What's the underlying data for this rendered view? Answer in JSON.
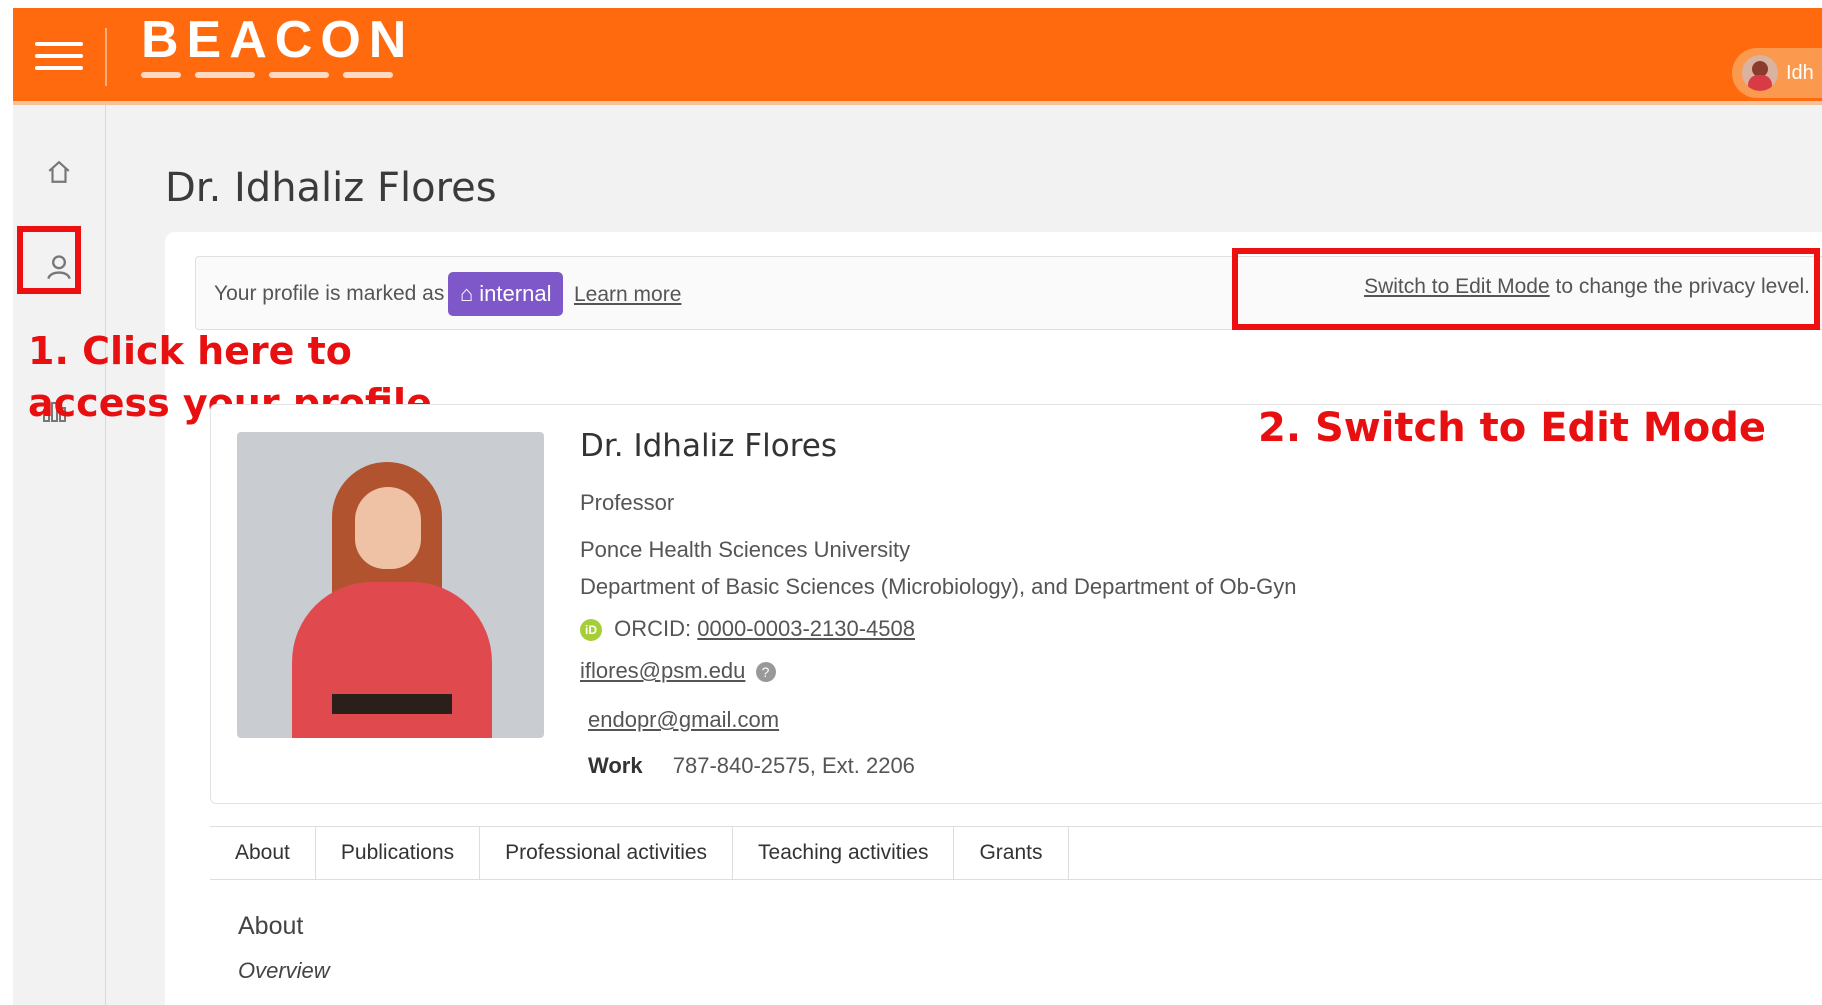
{
  "header": {
    "logo_text": "BEACON",
    "user_name": "Idh",
    "accent_color": "#ff6a0e"
  },
  "sidebar": {
    "items": [
      {
        "name": "home",
        "icon": "home-icon"
      },
      {
        "name": "profile",
        "icon": "user-icon"
      },
      {
        "name": "analytics",
        "icon": "bar-chart-icon"
      }
    ]
  },
  "page": {
    "title": "Dr. Idhaliz Flores"
  },
  "privacy": {
    "prefix": "Your profile is marked as",
    "badge_label": "internal",
    "badge_icon": "house-icon",
    "learn_more": "Learn more",
    "switch_link": "Switch to Edit Mode",
    "switch_suffix": "to change the privacy level."
  },
  "annotations": {
    "step1": "1. Click here to access your profile",
    "step2": "2. Switch to Edit Mode",
    "color": "#e80f10"
  },
  "profile": {
    "name": "Dr. Idhaliz Flores",
    "title": "Professor",
    "institution": "Ponce Health Sciences University",
    "department": "Department of Basic Sciences (Microbiology), and Department of Ob-Gyn",
    "orcid_label": "ORCID:",
    "orcid": "0000-0003-2130-4508",
    "email_primary": "iflores@psm.edu",
    "email_secondary": "endopr@gmail.com",
    "phone_label": "Work",
    "phone": "787-840-2575, Ext. 2206"
  },
  "tabs": [
    "About",
    "Publications",
    "Professional activities",
    "Teaching activities",
    "Grants"
  ],
  "about": {
    "heading": "About",
    "subheading": "Overview"
  }
}
